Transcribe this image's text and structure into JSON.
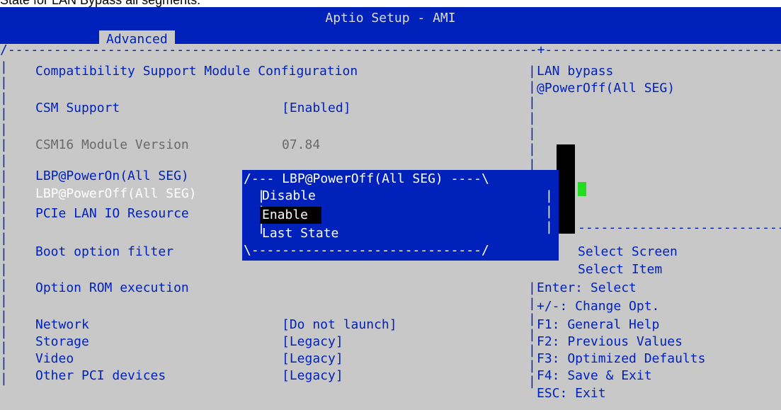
{
  "caption": "State  for LAN Bypass all segments.",
  "header": {
    "title": "Aptio Setup - AMI",
    "active_tab": "Advanced"
  },
  "main": {
    "section_title": "Compatibility Support Module Configuration",
    "csm_support": {
      "label": "CSM Support",
      "value": "[Enabled]"
    },
    "csm16_version": {
      "label": "CSM16 Module Version",
      "value": "07.84"
    },
    "lbp_power_on": {
      "label": "LBP@PowerOn(All SEG)"
    },
    "lbp_power_off": {
      "label": "LBP@PowerOff(All SEG)"
    },
    "pcie_lan": {
      "label": "PCIe LAN IO Resource"
    },
    "boot_filter": {
      "label": "Boot option filter"
    },
    "option_rom": {
      "label": "Option ROM execution"
    },
    "network": {
      "label": "Network",
      "value": "[Do not launch]"
    },
    "storage": {
      "label": "Storage",
      "value": "[Legacy]"
    },
    "video": {
      "label": "Video",
      "value": "[Legacy]"
    },
    "other_pci": {
      "label": "Other PCI devices",
      "value": "[Legacy]"
    }
  },
  "popup": {
    "title": "/--- LBP@PowerOff(All SEG) ----\\",
    "options": [
      "Disable",
      "Enable",
      "Last State"
    ],
    "bottom": "\\------------------------------/"
  },
  "help": {
    "line1": "LAN bypass",
    "line2": "@PowerOff(All SEG)",
    "keys": [
      "Select Screen",
      "Select Item",
      "Enter: Select",
      "+/-: Change Opt.",
      "F1: General Help",
      "F2: Previous Values",
      "F3: Optimized Defaults",
      "F4: Save & Exit",
      "ESC: Exit"
    ]
  }
}
